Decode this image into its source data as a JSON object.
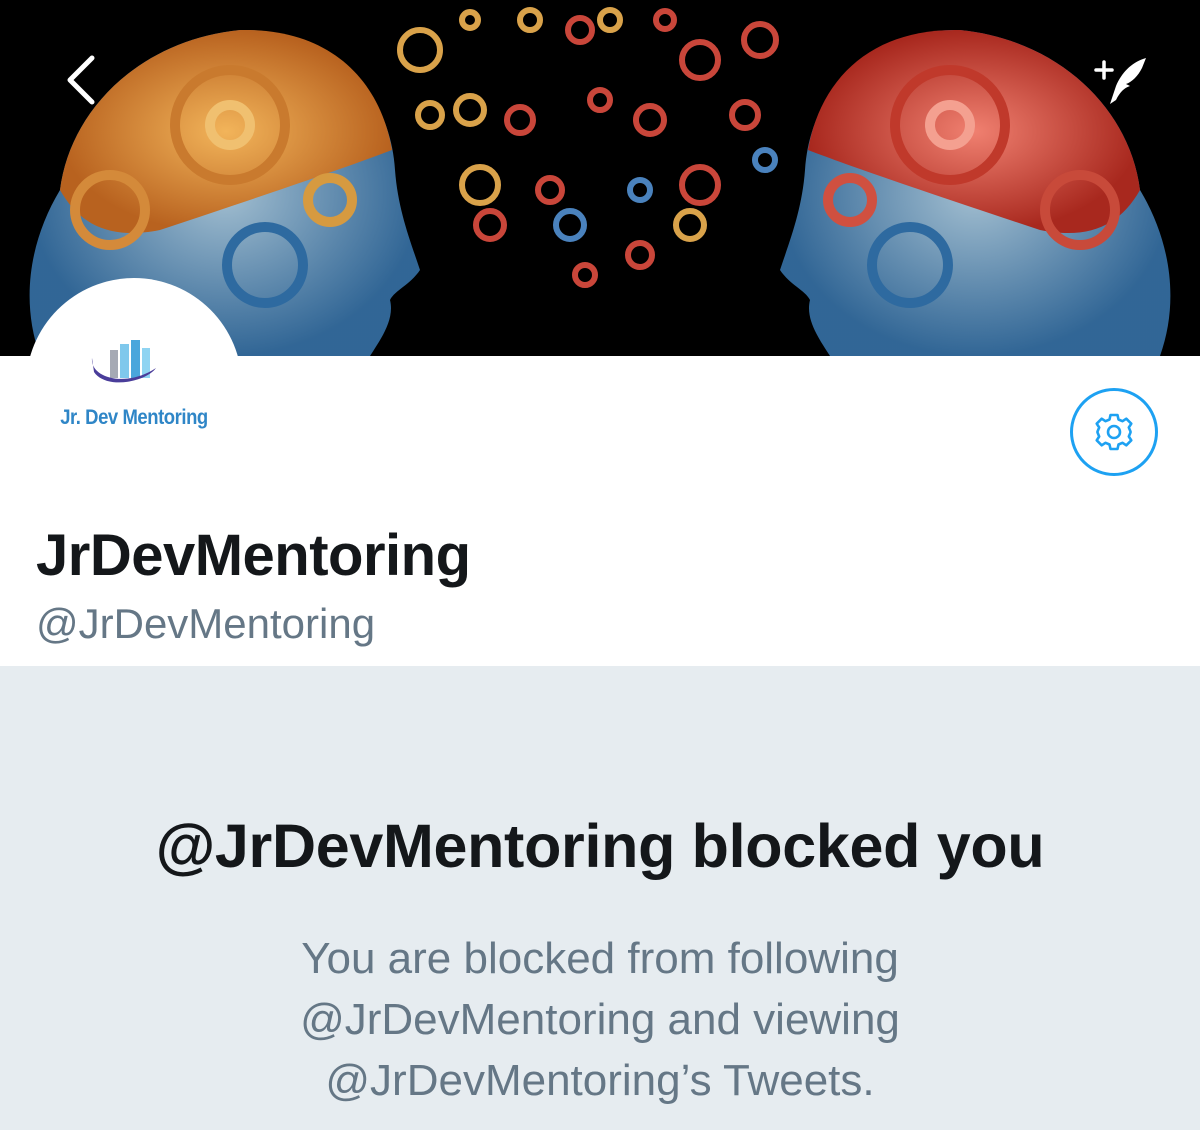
{
  "header": {
    "back_icon": "chevron-left-icon",
    "compose_icon": "compose-tweet-icon"
  },
  "avatar": {
    "logo_text": "Jr. Dev Mentoring"
  },
  "profile": {
    "display_name": "JrDevMentoring",
    "handle": "@JrDevMentoring",
    "settings_icon": "gear-icon"
  },
  "blocked": {
    "title": "@JrDevMentoring blocked you",
    "line1": "You are blocked from following",
    "line2": "@JrDevMentoring and viewing",
    "line3": "@JrDevMentoring’s Tweets."
  },
  "colors": {
    "accent": "#1da1f2",
    "text_primary": "#14171a",
    "text_secondary": "#657786",
    "background": "#e6ecf0"
  }
}
